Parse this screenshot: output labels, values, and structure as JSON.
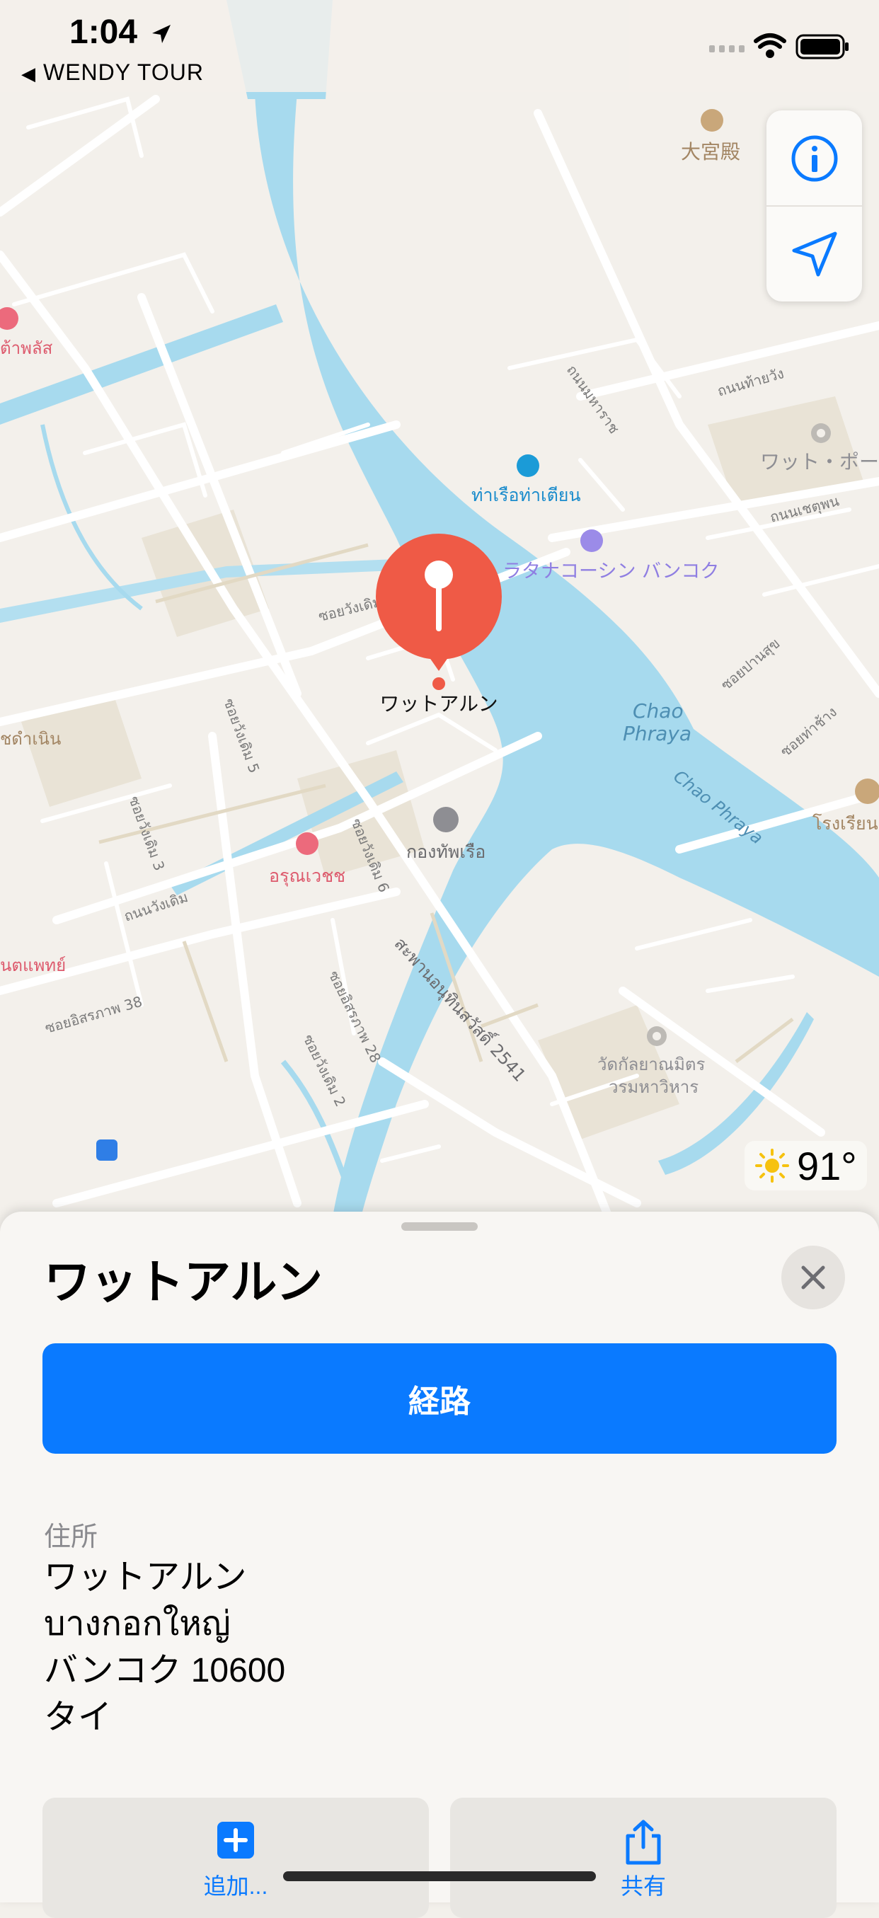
{
  "status_bar": {
    "time": "1:04",
    "back_label": "WENDY TOUR"
  },
  "map": {
    "labels": {
      "grand_palace": "大宮殿",
      "wat_pho": "ワット・ポー",
      "pier": "ท่าเรือท่าเตียน",
      "hotel": "ラタナコーシン バンコク",
      "pin_label": "ワットアルン",
      "river1": "Chao",
      "river2": "Phraya",
      "river_diag": "Chao Phraya",
      "navy": "กองทัพเรือ",
      "arun_hosp": "อรุณเวชช",
      "wat_kalaya1": "วัดกัลยาณมิตร",
      "wat_kalaya2": "วรมหาวิหาร",
      "school": "โรงเรียน",
      "left_pink": "ต้าพลัส",
      "left_pink2": "ันตแพทย์",
      "left_road": "ชดำเนิน",
      "road1": "ถนนท้ายวัง",
      "road2": "ถนนมหาราช",
      "road3": "ถนนเชตุพน",
      "road4": "ซอยปานสุข",
      "road5": "ซอยท่าช้าง",
      "road6": "ซอยวังเดิม",
      "road7": "ซอยวังเดิม 5",
      "road8": "ซอยวังเดิม 3",
      "road9": "ถนนวังเดิม",
      "road10": "ซอยวังเดิม 6",
      "road11": "ซอยอิสรภาพ 38",
      "road12": "ซอยอิสรภาพ 28",
      "road13": "ซอยวังเดิม 2",
      "road14": "สะพานอนุทินสวัสดิ์ 2541"
    },
    "weather": "91°"
  },
  "sheet": {
    "title": "ワットアルン",
    "route_button": "経路",
    "address_label": "住所",
    "address_lines": [
      "ワットアルン",
      "บางกอกใหญ่",
      "バンコク 10600",
      "タイ"
    ],
    "add_label": "追加...",
    "share_label": "共有"
  },
  "colors": {
    "accent": "#0a7aff",
    "pin": "#ef5a46",
    "water": "#a7daee",
    "land": "#f3f0eb"
  }
}
